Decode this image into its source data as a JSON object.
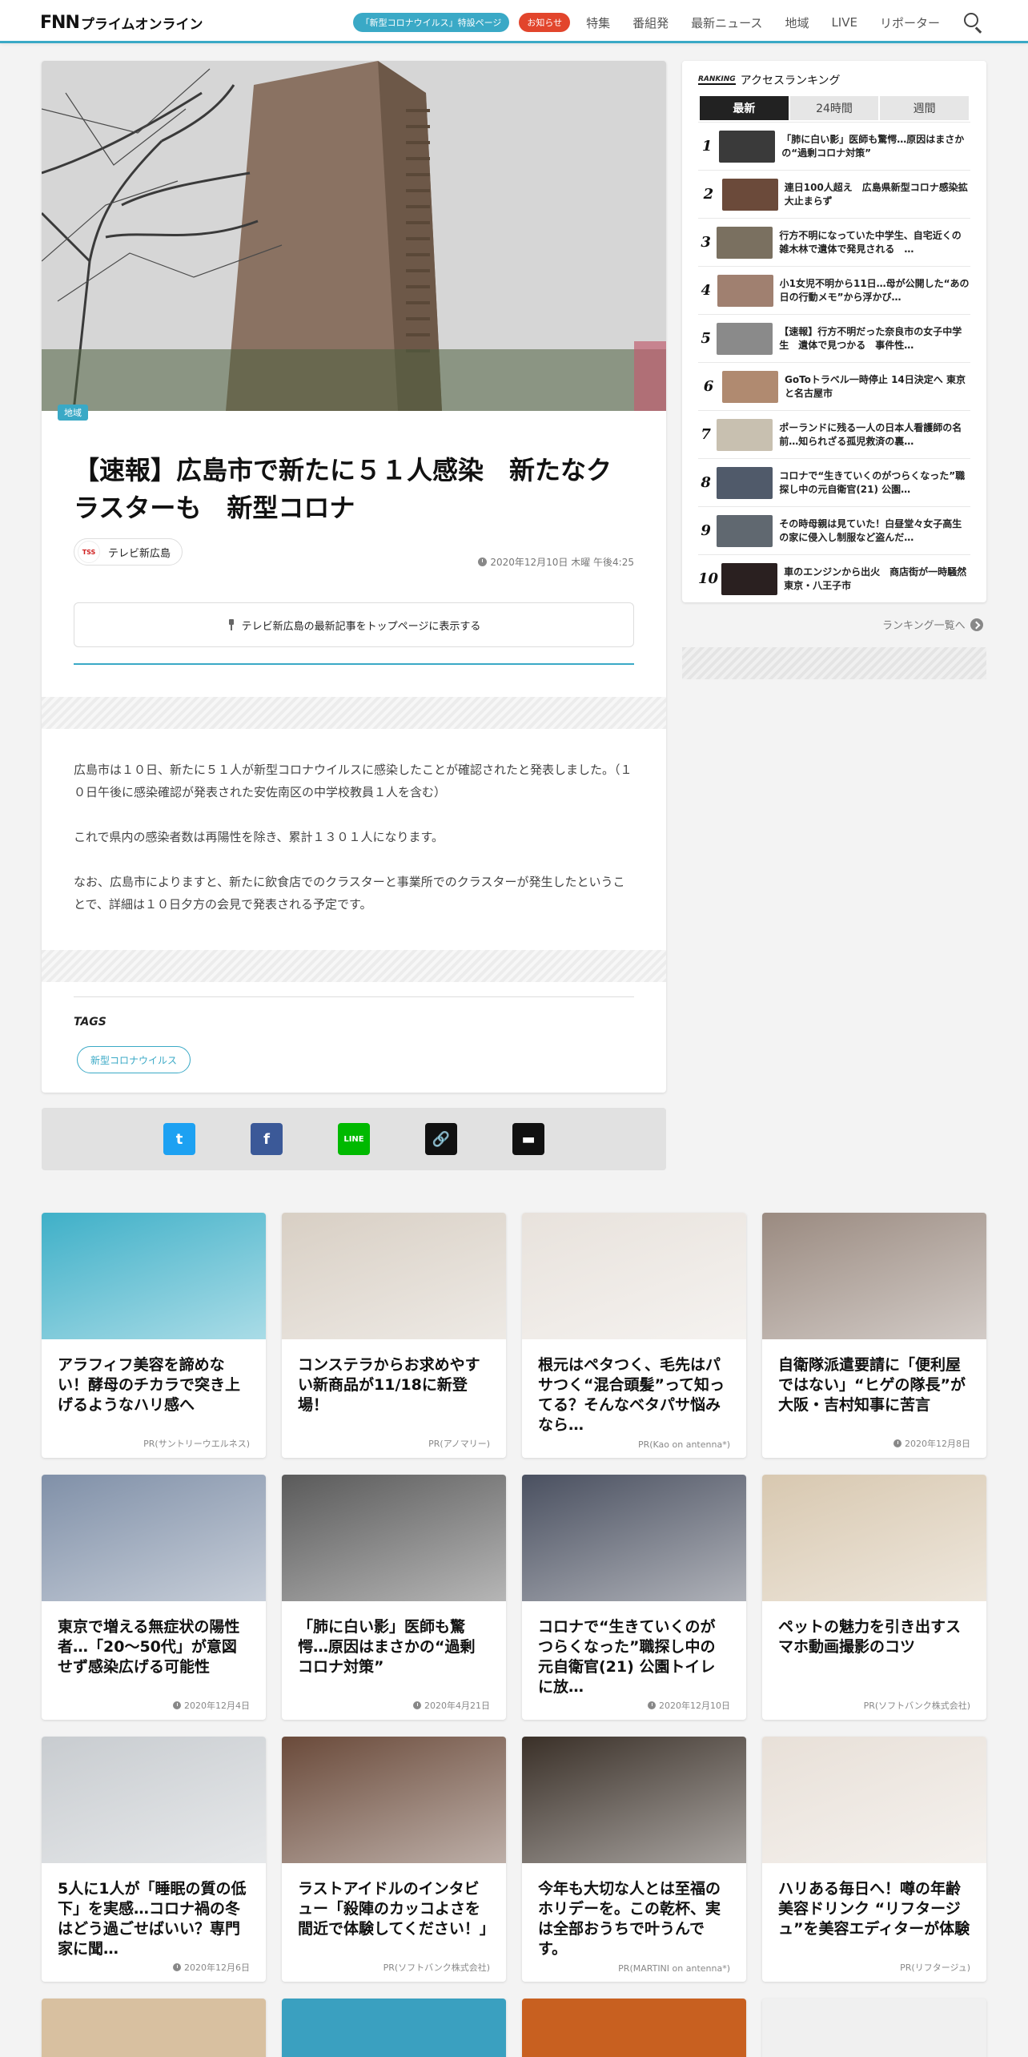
{
  "header": {
    "logo_fnn": "FNN",
    "logo_text": "プライムオンライン",
    "pill_corona": "「新型コロナウイルス」特設ページ",
    "pill_notice": "お知らせ",
    "nav": [
      "特集",
      "番組発",
      "最新ニュース",
      "地域",
      "LIVE",
      "リポーター"
    ]
  },
  "article": {
    "region_tag": "地域",
    "headline": "【速報】広島市で新たに５１人感染　新たなクラスターも　新型コロナ",
    "source_logo": "TSS",
    "source_name": "テレビ新広島",
    "date": "2020年12月10日 木曜 午後4:25",
    "follow_label": "テレビ新広島の最新記事をトップページに表示する",
    "paragraphs": [
      "広島市は１０日、新たに５１人が新型コロナウイルスに感染したことが確認されたと発表しました。（１０日午後に感染確認が発表された安佐南区の中学校教員１人を含む）",
      "これで県内の感染者数は再陽性を除き、累計１３０１人になります。",
      "なお、広島市によりますと、新たに飲食店でのクラスターと事業所でのクラスターが発生したということで、詳細は１０日夕方の会見で発表される予定です。"
    ],
    "tags_title": "TAGS",
    "tags": [
      "新型コロナウイルス"
    ]
  },
  "share": {
    "twitter": "t",
    "facebook": "f",
    "line": "LINE",
    "link": "🔗",
    "comment": "▬"
  },
  "ranking": {
    "en": "RANKING",
    "title": "アクセスランキング",
    "tabs": [
      "最新",
      "24時間",
      "週間"
    ],
    "items": [
      {
        "num": "1",
        "title": "「肺に白い影」医師も驚愕…原因はまさかの“過剰コロナ対策”",
        "color": "#3a3a3a"
      },
      {
        "num": "2",
        "title": "連日100人超え　広島県新型コロナ感染拡大止まらず",
        "color": "#6b4a3a"
      },
      {
        "num": "3",
        "title": "行方不明になっていた中学生、自宅近くの雑木林で遺体で発見される　…",
        "color": "#7a7060"
      },
      {
        "num": "4",
        "title": "小1女児不明から11日…母が公開した“あの日の行動メモ”から浮かび…",
        "color": "#a08070"
      },
      {
        "num": "5",
        "title": "【速報】行方不明だった奈良市の女子中学生　遺体で見つかる　事件性…",
        "color": "#8a8a8a"
      },
      {
        "num": "6",
        "title": "GoToトラベル一時停止 14日決定へ 東京と名古屋市",
        "color": "#b08a70"
      },
      {
        "num": "7",
        "title": "ポーランドに残る一人の日本人看護師の名前…知られざる孤児救済の裏…",
        "color": "#c8c0b0"
      },
      {
        "num": "8",
        "title": "コロナで“生きていくのがつらくなった”職探し中の元自衛官(21) 公園…",
        "color": "#505a6a"
      },
      {
        "num": "9",
        "title": "その時母親は見ていた！白昼堂々女子高生の家に侵入し制服など盗んだ…",
        "color": "#606870"
      },
      {
        "num": "10",
        "title": "車のエンジンから出火　商店街が一時騒然　東京・八王子市",
        "color": "#2a2020"
      }
    ],
    "more": "ランキング一覧へ"
  },
  "cards": [
    {
      "title": "アラフィフ美容を諦めない！酵母のチカラで突き上げるようなハリ感へ",
      "meta": "PR(サントリーウエルネス)",
      "dated": false,
      "color": "#3fb0c8"
    },
    {
      "title": "コンステラからお求めやすい新商品が11/18に新登場！",
      "meta": "PR(アノマリー)",
      "dated": false,
      "color": "#d8cfc4"
    },
    {
      "title": "根元はペタつく、毛先はパサつく“混合頭髪”って知ってる？そんなベタパサ悩みなら…",
      "meta": "PR(Kao on antenna*)",
      "dated": false,
      "color": "#e8e2dc"
    },
    {
      "title": "自衛隊派遣要請に「便利屋ではない」“ヒゲの隊長”が大阪・吉村知事に苦言",
      "meta": "2020年12月8日",
      "dated": true,
      "color": "#9a8a80"
    },
    {
      "title": "東京で増える無症状の陽性者…「20～50代」が意図せず感染広げる可能性",
      "meta": "2020年12月4日",
      "dated": true,
      "color": "#8090a8"
    },
    {
      "title": "「肺に白い影」医師も驚愕…原因はまさかの“過剰コロナ対策”",
      "meta": "2020年4月21日",
      "dated": true,
      "color": "#5a5a5a"
    },
    {
      "title": "コロナで“生きていくのがつらくなった”職探し中の元自衛官(21) 公園トイレに放…",
      "meta": "2020年12月10日",
      "dated": true,
      "color": "#4a5060"
    },
    {
      "title": "ペットの魅力を引き出すスマホ動画撮影のコツ",
      "meta": "PR(ソフトバンク株式会社)",
      "dated": false,
      "color": "#d8c8b0"
    },
    {
      "title": "5人に1人が「睡眠の質の低下」を実感…コロナ禍の冬はどう過ごせばいい？専門家に聞…",
      "meta": "2020年12月6日",
      "dated": true,
      "color": "#c8ccd0"
    },
    {
      "title": "ラストアイドルのインタビュー「殺陣のカッコよさを間近で体験してください！」",
      "meta": "PR(ソフトバンク株式会社)",
      "dated": false,
      "color": "#6a4a3a"
    },
    {
      "title": "今年も大切な人とは至福のホリデーを。この乾杯、実は全部おうちで叶うんです。",
      "meta": "PR(MARTINI on antenna*)",
      "dated": false,
      "color": "#3a3028"
    },
    {
      "title": "ハリある毎日へ！噂の年齢美容ドリンク “リフタージュ”を美容エディターが体験",
      "meta": "PR(リフタージュ)",
      "dated": false,
      "color": "#e8e0d8"
    }
  ],
  "bottom_cards": [
    {
      "color": "#d8c0a0"
    },
    {
      "color": "#3aa0c0"
    },
    {
      "color": "#c86020"
    },
    {
      "color": "#f0f0f0"
    }
  ]
}
